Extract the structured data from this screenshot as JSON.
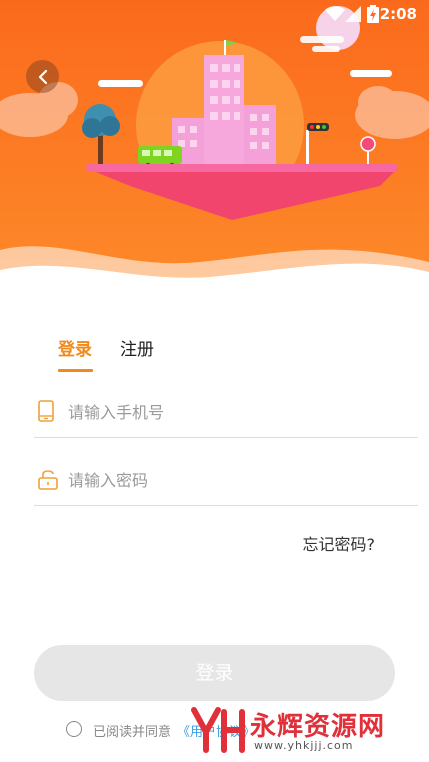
{
  "status_bar": {
    "time": "2:08",
    "icons": [
      "wifi-icon",
      "signal-icon",
      "battery-charging-icon"
    ]
  },
  "header": {
    "back_icon": "chevron-left-icon",
    "illustration": "floating-city-island-illustration"
  },
  "tabs": [
    {
      "label": "登录",
      "active": true
    },
    {
      "label": "注册",
      "active": false
    }
  ],
  "form": {
    "phone": {
      "placeholder": "请输入手机号",
      "value": "",
      "icon": "phone-icon"
    },
    "password": {
      "placeholder": "请输入密码",
      "value": "",
      "icon": "lock-icon"
    },
    "forgot_label": "忘记密码?",
    "submit_label": "登录"
  },
  "agreement": {
    "checked": false,
    "text": "已阅读并同意",
    "link": "《用户协议》"
  },
  "watermark": {
    "title": "永辉资源网",
    "url": "www.yhkjjj.com"
  },
  "colors": {
    "accent": "#f08a1c",
    "hero_orange": "#fb6a1e",
    "button_disabled": "#e6e6e6",
    "link": "#3aa0e0",
    "watermark_red": "#e0303a"
  }
}
